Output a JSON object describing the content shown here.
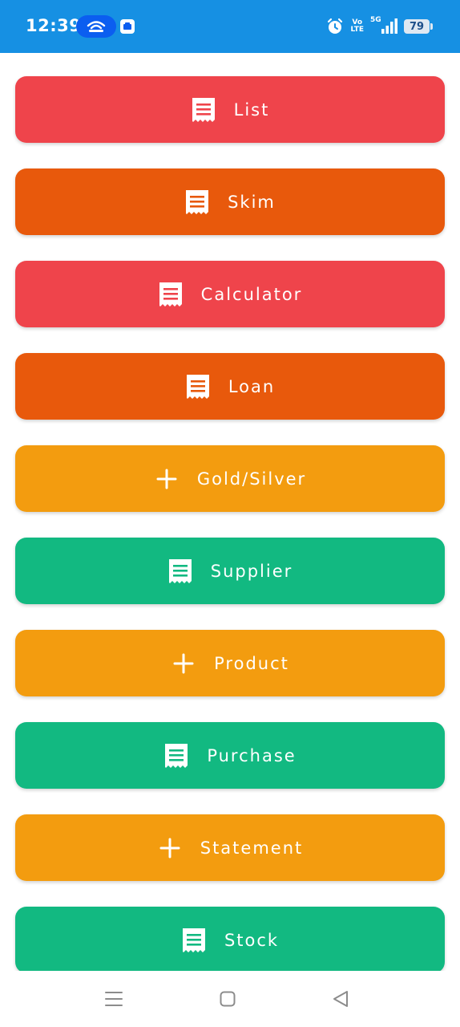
{
  "status_bar": {
    "time": "12:39",
    "network": "5G",
    "volte_top": "Vo",
    "volte_bottom": "LTE",
    "battery": "79",
    "background": "#1690e3"
  },
  "menu": {
    "items": [
      {
        "label": "List",
        "icon": "receipt-icon",
        "color": "#ef444b"
      },
      {
        "label": "Skim",
        "icon": "receipt-icon",
        "color": "#e8590c"
      },
      {
        "label": "Calculator",
        "icon": "receipt-icon",
        "color": "#ef444b"
      },
      {
        "label": "Loan",
        "icon": "receipt-icon",
        "color": "#e8590c"
      },
      {
        "label": "Gold/Silver",
        "icon": "plus-icon",
        "color": "#f39c0f"
      },
      {
        "label": "Supplier",
        "icon": "receipt-icon",
        "color": "#12b981"
      },
      {
        "label": "Product",
        "icon": "plus-icon",
        "color": "#f39c0f"
      },
      {
        "label": "Purchase",
        "icon": "receipt-icon",
        "color": "#12b981"
      },
      {
        "label": "Statement",
        "icon": "plus-icon",
        "color": "#f39c0f"
      },
      {
        "label": "Stock",
        "icon": "receipt-icon",
        "color": "#12b981"
      }
    ]
  },
  "nav_bar": {
    "buttons": [
      "menu-lines-icon",
      "home-square-icon",
      "back-triangle-icon"
    ]
  }
}
